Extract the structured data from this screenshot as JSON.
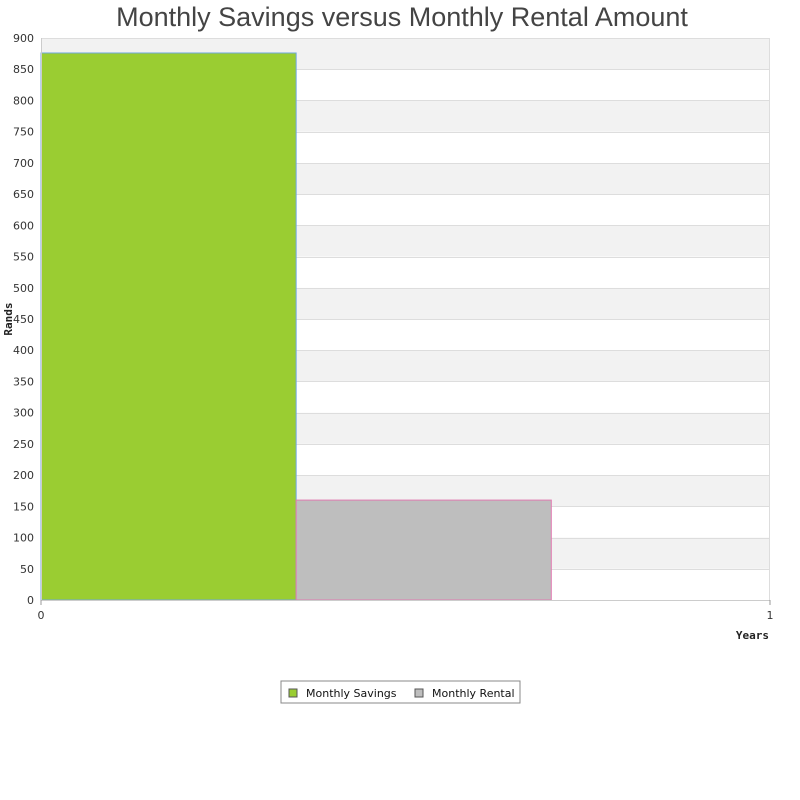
{
  "chart_data": {
    "type": "bar",
    "title": "Monthly Savings versus Monthly Rental Amount",
    "xlabel": "Years",
    "ylabel": "Rands",
    "xlim": [
      0,
      1
    ],
    "ylim": [
      0,
      900
    ],
    "x_ticks": [
      "0",
      "1"
    ],
    "y_ticks": [
      0,
      50,
      100,
      150,
      200,
      250,
      300,
      350,
      400,
      450,
      500,
      550,
      600,
      650,
      700,
      750,
      800,
      850,
      900
    ],
    "series": [
      {
        "name": "Monthly Savings",
        "values": [
          876
        ],
        "color": "#9acd32",
        "border_color": "#6fa8dc"
      },
      {
        "name": "Monthly Rental",
        "values": [
          160
        ],
        "color": "#bebebe",
        "border_color": "#e07ab0"
      }
    ],
    "grid": true,
    "alternating_band_color": "#f2f2f2",
    "legend_position": "bottom-center"
  }
}
